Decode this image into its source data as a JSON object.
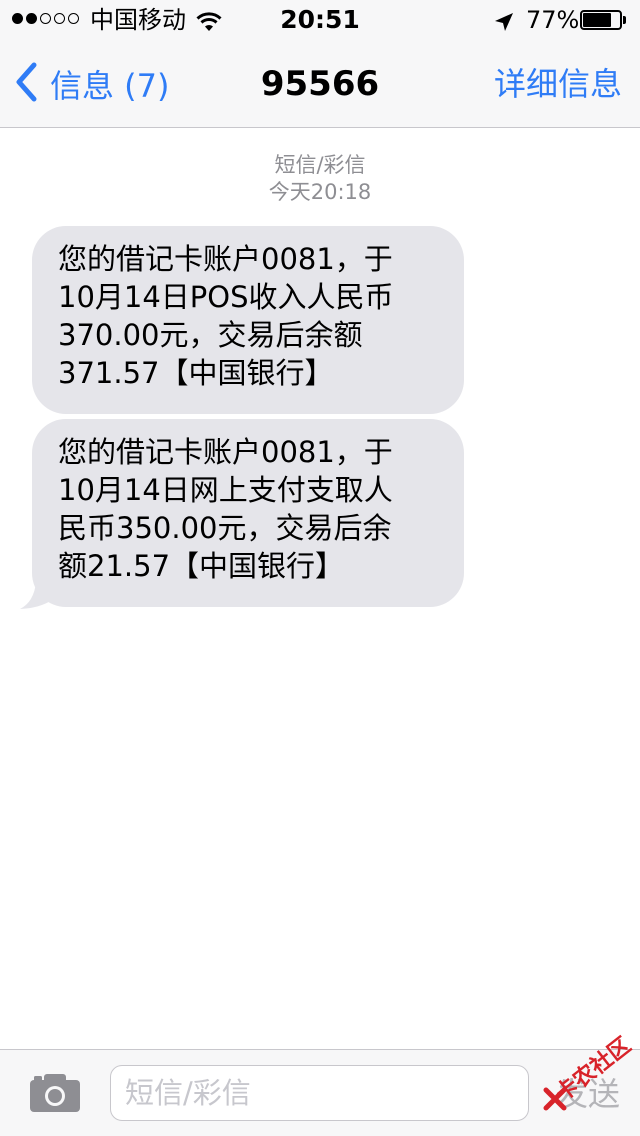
{
  "status_bar": {
    "signal_dots_filled": 2,
    "signal_dots_total": 5,
    "carrier": "中国移动",
    "time": "20:51",
    "battery_percent_label": "77%",
    "battery_level": 0.77,
    "icons": [
      "wifi-icon",
      "location-arrow-icon",
      "battery-icon"
    ]
  },
  "nav": {
    "back_label": "信息 (7)",
    "title": "95566",
    "details_label": "详细信息",
    "accent_color": "#2f7cf6"
  },
  "thread": {
    "type_label": "短信/彩信",
    "timestamp": "今天20:18"
  },
  "messages": [
    {
      "lines": [
        "您的借记卡账户0081，于",
        "10月14日POS收入人民币",
        "370.00元，交易后余额",
        "371.57【中国银行】"
      ]
    },
    {
      "lines": [
        "您的借记卡账户0081，于",
        "10月14日网上支付支取人",
        "民币350.00元，交易后余",
        "额21.57【中国银行】"
      ]
    }
  ],
  "input_bar": {
    "placeholder": "短信/彩信",
    "send_label": "发送",
    "camera_icon": "camera-icon"
  },
  "watermark": {
    "text": "卡农社区"
  }
}
